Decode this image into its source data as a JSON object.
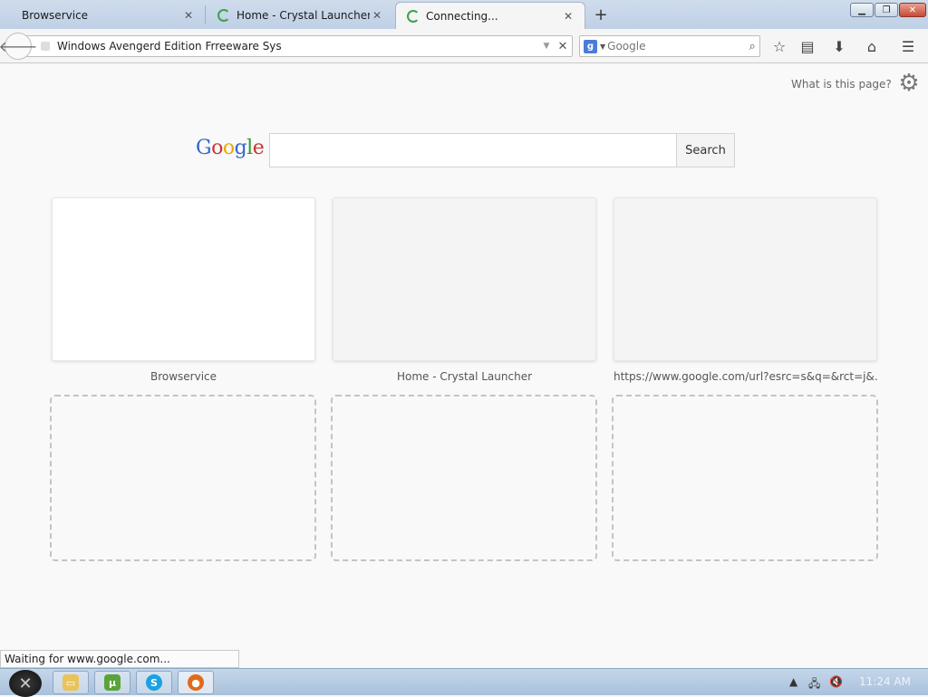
{
  "tabs": [
    {
      "title": "Browservice",
      "state": "inactive"
    },
    {
      "title": "Home - Crystal Launcher",
      "state": "inactive"
    },
    {
      "title": "Connecting...",
      "state": "active"
    }
  ],
  "toolbar": {
    "url_value": "Windows Avengerd Edition Frreeware Sys",
    "search_placeholder": "Google"
  },
  "newtab": {
    "help_link": "What is this page?",
    "google_logo": {
      "G": "G",
      "o1": "o",
      "o2": "o",
      "g": "g",
      "l": "l",
      "e": "e"
    },
    "search_button": "Search",
    "tiles": [
      {
        "caption": "Browservice"
      },
      {
        "caption": "Home - Crystal Launcher"
      },
      {
        "caption": "https://www.google.com/url?esrc=s&q=&rct=j&..."
      }
    ]
  },
  "status": "Waiting for www.google.com...",
  "taskbar": {
    "clock": "11:24 AM"
  },
  "colors": {
    "tabstrip": "#c6d6ea",
    "accent_green": "#3aa34a",
    "taskbar": "#b3c8e0"
  }
}
